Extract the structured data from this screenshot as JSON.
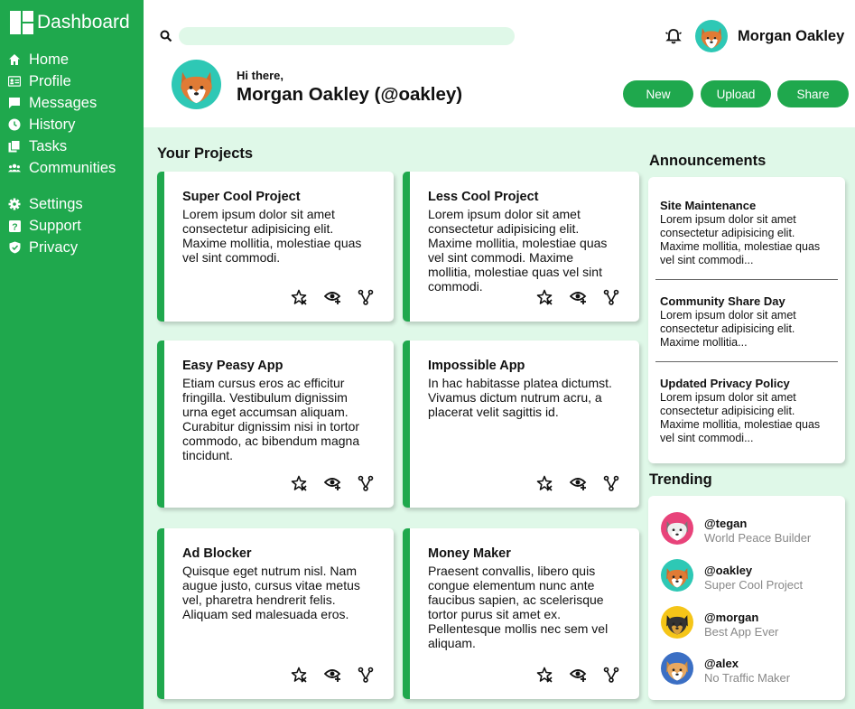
{
  "app": {
    "title": "Dashboard"
  },
  "sidebar": {
    "items": [
      {
        "label": "Home",
        "icon": "home-icon"
      },
      {
        "label": "Profile",
        "icon": "id-card-icon"
      },
      {
        "label": "Messages",
        "icon": "chat-icon"
      },
      {
        "label": "History",
        "icon": "clock-icon"
      },
      {
        "label": "Tasks",
        "icon": "copy-icon"
      },
      {
        "label": "Communities",
        "icon": "group-icon"
      }
    ],
    "secondary": [
      {
        "label": "Settings",
        "icon": "gear-icon"
      },
      {
        "label": "Support",
        "icon": "help-icon"
      },
      {
        "label": "Privacy",
        "icon": "shield-icon"
      }
    ]
  },
  "header": {
    "search_placeholder": "",
    "user_name": "Morgan Oakley",
    "greeting": "Hi there,",
    "full_name": "Morgan Oakley (@oakley)",
    "buttons": {
      "new": "New",
      "upload": "Upload",
      "share": "Share"
    }
  },
  "projects": {
    "title": "Your Projects",
    "items": [
      {
        "title": "Super Cool Project",
        "body": "Lorem ipsum dolor sit amet consectetur adipisicing elit. Maxime mollitia, molestiae quas vel sint commodi."
      },
      {
        "title": "Less Cool Project",
        "body": "Lorem ipsum dolor sit amet consectetur adipisicing elit. Maxime mollitia, molestiae quas vel sint commodi. Maxime mollitia, molestiae quas vel sint commodi."
      },
      {
        "title": "Easy Peasy App",
        "body": "Etiam cursus eros ac efficitur fringilla. Vestibulum dignissim urna eget accumsan aliquam. Curabitur dignissim nisi in tortor commodo, ac bibendum magna tincidunt."
      },
      {
        "title": "Impossible App",
        "body": "In hac habitasse platea dictumst. Vivamus dictum nutrum acru, a placerat velit sagittis id."
      },
      {
        "title": "Ad Blocker",
        "body": "Quisque eget nutrum nisl. Nam augue justo, cursus vitae metus vel, pharetra hendrerit felis. Aliquam sed malesuada eros."
      },
      {
        "title": "Money Maker",
        "body": "Praesent convallis, libero quis congue elementum nunc ante faucibus sapien, ac scelerisque tortor purus sit amet ex. Pellentesque mollis nec sem vel aliquam."
      }
    ]
  },
  "announcements": {
    "title": "Announcements",
    "items": [
      {
        "title": "Site Maintenance",
        "body": "Lorem ipsum dolor sit amet consectetur adipisicing elit. Maxime mollitia, molestiae quas vel sint commodi..."
      },
      {
        "title": "Community Share Day",
        "body": "Lorem ipsum dolor sit amet consectetur adipisicing elit. Maxime mollitia..."
      },
      {
        "title": "Updated Privacy Policy",
        "body": "Lorem ipsum dolor sit amet consectetur adipisicing elit. Maxime mollitia, molestiae quas vel sint commodi..."
      }
    ]
  },
  "trending": {
    "title": "Trending",
    "items": [
      {
        "handle": "@tegan",
        "subtitle": "World Peace Builder",
        "bg": "#e8437a"
      },
      {
        "handle": "@oakley",
        "subtitle": "Super Cool Project",
        "bg": "#2ec8b5"
      },
      {
        "handle": "@morgan",
        "subtitle": "Best App Ever",
        "bg": "#f5c518"
      },
      {
        "handle": "@alex",
        "subtitle": "No Traffic Maker",
        "bg": "#3b6fc4"
      }
    ]
  },
  "colors": {
    "accent": "#1fa84d",
    "page_bg": "#dff8e8"
  }
}
